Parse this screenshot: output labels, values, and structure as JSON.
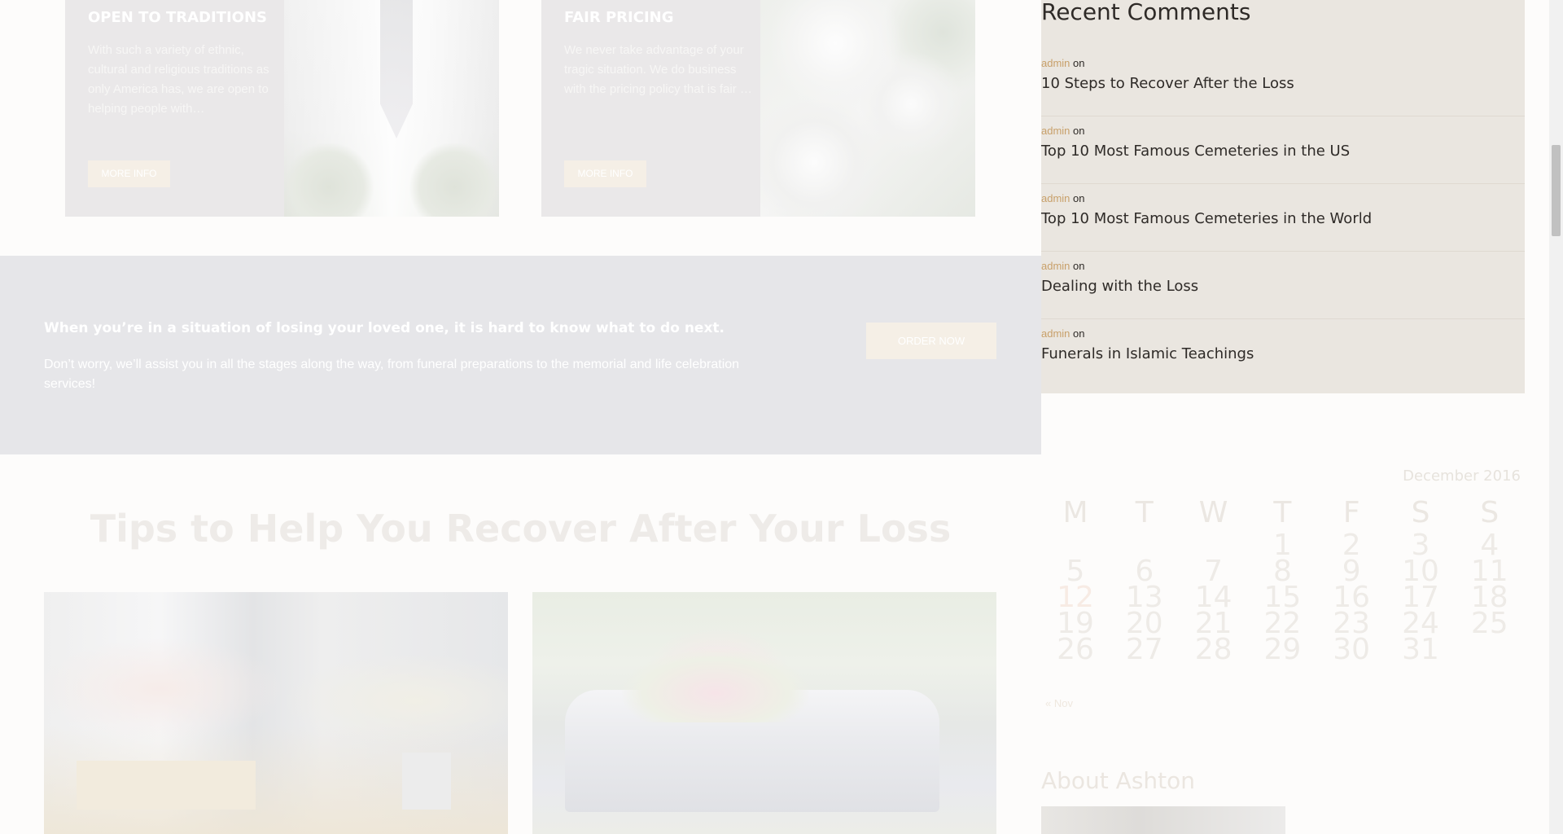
{
  "services": [
    {
      "title": "OPEN TO TRADITIONS",
      "text": "With such a variety of ethnic, cultural and religious traditions as only America has, we are open to helping people with…",
      "button": "MORE INFO"
    },
    {
      "title": "FAIR PRICING",
      "text": "We never take advantage of your tragic situation. We do business with the pricing policy that is fair …",
      "button": "MORE INFO"
    }
  ],
  "cta": {
    "heading": "When you’re in a situation of losing your loved one, it is hard to know what to do next.",
    "text": "Don’t worry, we’ll assist you in all the stages along the way, from funeral preparations to the memorial and life celebration services!",
    "button": "ORDER NOW"
  },
  "tips": {
    "title": "Tips to Help You Recover After Your Loss"
  },
  "sidebar": {
    "recent_comments": {
      "title": "Recent Comments",
      "items": [
        {
          "author": "admin",
          "on": "on",
          "post": "10 Steps to Recover After the Loss"
        },
        {
          "author": "admin",
          "on": "on",
          "post": "Top 10 Most Famous Cemeteries in the US"
        },
        {
          "author": "admin",
          "on": "on",
          "post": "Top 10 Most Famous Cemeteries in the World"
        },
        {
          "author": "admin",
          "on": "on",
          "post": "Dealing with the Loss"
        },
        {
          "author": "admin",
          "on": "on",
          "post": "Funerals in Islamic Teachings"
        }
      ]
    },
    "calendar": {
      "caption": "December 2016",
      "weekdays": [
        "M",
        "T",
        "W",
        "T",
        "F",
        "S",
        "S"
      ],
      "weeks": [
        [
          "",
          "",
          "",
          "1",
          "2",
          "3",
          "4"
        ],
        [
          "5",
          "6",
          "7",
          "8",
          "9",
          "10",
          "11"
        ],
        [
          "12",
          "13",
          "14",
          "15",
          "16",
          "17",
          "18"
        ],
        [
          "19",
          "20",
          "21",
          "22",
          "23",
          "24",
          "25"
        ],
        [
          "26",
          "27",
          "28",
          "29",
          "30",
          "31",
          ""
        ]
      ],
      "today": "12",
      "prev": "« Nov"
    },
    "about": {
      "title": "About Ashton"
    }
  },
  "colors": {
    "accent": "#c8a06a",
    "dark_text": "#2e2a27",
    "sidebar_bg": "#eae6e0",
    "cta_bg": "#e6e6e9"
  }
}
